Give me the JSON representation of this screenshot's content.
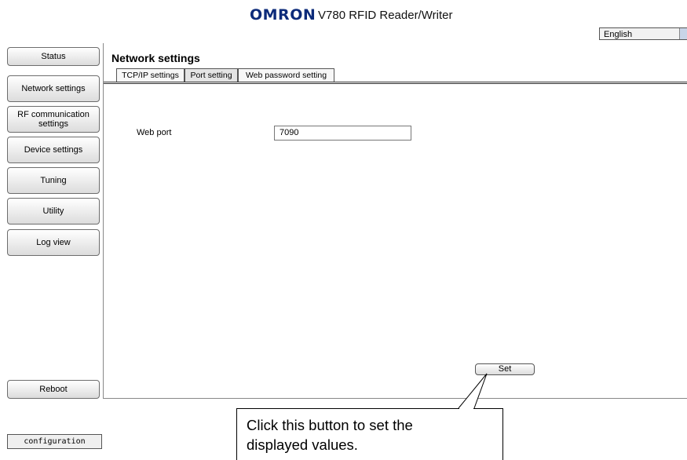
{
  "header": {
    "brand": "OMRON",
    "product": "V780 RFID Reader/Writer"
  },
  "language_select": {
    "value": "English"
  },
  "sidebar": {
    "items": [
      {
        "label": "Status"
      },
      {
        "label": "Network settings"
      },
      {
        "label": "RF communication settings"
      },
      {
        "label": "Device settings"
      },
      {
        "label": "Tuning"
      },
      {
        "label": "Utility"
      },
      {
        "label": "Log view"
      }
    ],
    "reboot_label": "Reboot"
  },
  "main": {
    "title": "Network settings",
    "tabs": [
      {
        "label": "TCP/IP settings"
      },
      {
        "label": "Port setting"
      },
      {
        "label": "Web password setting"
      }
    ],
    "active_tab": "Port setting",
    "fields": [
      {
        "label": "Web port",
        "value": "7090"
      }
    ],
    "set_label": "Set"
  },
  "configuration_label": "configuration",
  "callout": {
    "text_line1": "Click this button to set the",
    "text_line2": "displayed values."
  }
}
